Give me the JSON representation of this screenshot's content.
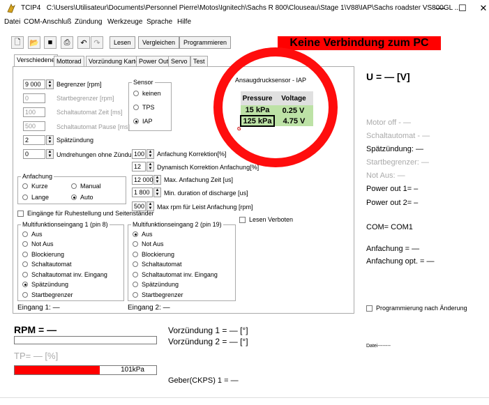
{
  "window": {
    "app_name": "TCIP4",
    "path": "C:\\Users\\Utilisateur\\Documents\\Personnel Pierre\\Motos\\Ignitech\\Sachs R 800\\Clouseau\\Stage 1\\V88\\IAP\\Sachs roadster VS800GL ...",
    "minimize": "—",
    "maximize": "☐",
    "close": "✕"
  },
  "menu": [
    "Datei",
    "COM-Anschluß",
    "Zündung",
    "Werkzeuge",
    "Sprache",
    "Hilfe"
  ],
  "toolbar": {
    "icons": [
      "new-file-icon",
      "open-folder-icon",
      "save-icon",
      "print-icon",
      "undo-icon",
      "redo-icon"
    ],
    "lesen": "Lesen",
    "vergleichen": "Vergleichen",
    "programmieren": "Programmieren",
    "status_banner": "Keine Verbindung zum PC",
    "status_color": "#ff0000"
  },
  "tabs": [
    "Verschiedene",
    "Mottorad",
    "Vorzündung Karte",
    "Power Out",
    "Servo",
    "Test"
  ],
  "left": {
    "begrenzer_val": "9 000",
    "begrenzer_lbl": "Begrenzer [rpm]",
    "startbegrenzer_val": "0",
    "startbegrenzer_lbl": "Startbegrenzer [rpm]",
    "schaltautomat_zeit_val": "100",
    "schaltautomat_zeit_lbl": "Schaltautomat Zeit [ms]",
    "schaltautomat_pause_val": "500",
    "schaltautomat_pause_lbl": "Schaltautomat Pause [ms]",
    "spaetzuendung_val": "2",
    "spaetzuendung_lbl": "Spätzündung",
    "umdrehungen_val": "0",
    "umdrehungen_lbl": "Umdrehungen ohne Zündung"
  },
  "sensor": {
    "title": "Sensor",
    "options": [
      "keinen",
      "TPS",
      "IAP"
    ],
    "selected": 2
  },
  "anfachung": {
    "title": "Anfachung",
    "options": [
      "Kurze",
      "Manual",
      "Lange",
      "Auto"
    ],
    "selected": 3
  },
  "mid": {
    "max_anfachung_korr_val": "100",
    "max_anfachung_korr_lbl": "Anfachung Korrektion[%]",
    "dyn_korr_val": "12",
    "dyn_korr_lbl": "Dynamisch Korrektion Anfachung[%]",
    "max_anf_zeit_val": "12 000",
    "max_anf_zeit_lbl": "Max. Anfachung Zeit  [us]",
    "min_duration_val": "1 800",
    "min_duration_lbl": "Min. duration of discharge [us]",
    "max_rpm_val": "500",
    "max_rpm_lbl": "Max rpm für Leist Anfachung [rpm]"
  },
  "eingaenge_label": "Eingänge für Ruhestellung und Seitenständer",
  "lesen_verboten": "Lesen Verboten",
  "mf1": {
    "title": "Multifunktionseingang 1 (pin 8)",
    "options": [
      "Aus",
      "Not Aus",
      "Blockierung",
      "Schaltautomat",
      "Schaltautomat inv. Eingang",
      "Spätzündung",
      "Startbegrenzer"
    ],
    "selected": 5,
    "status": "Eingang 1: —"
  },
  "mf2": {
    "title": "Multifunktionseingang 2 (pin 19)",
    "options": [
      "Aus",
      "Not Aus",
      "Blockierung",
      "Schaltautomat",
      "Schaltautomat inv. Eingang",
      "Spätzündung",
      "Startbegrenzer"
    ],
    "selected": 0,
    "status": "Eingang 2: —"
  },
  "iap": {
    "title": "Ansaugdrucksensor - IAP",
    "headers": [
      "Pressure",
      "Voltage"
    ],
    "rows": [
      [
        "15 kPa",
        "0.25 V"
      ],
      [
        "125 kPa",
        "4.75 V"
      ]
    ],
    "marker": "G"
  },
  "right": {
    "voltage": "U = — [V]",
    "motor_off": "Motor off - —",
    "schaltautomat": "Schaltautomat - —",
    "spaetzuendung": "Spätzündung: —",
    "startbegrenzer": "Startbegrenzer: —",
    "not_aus": "Not Aus: —",
    "power_out1": "Power out 1= –",
    "power_out2": "Power out 2= –",
    "com": "COM= COM1",
    "anfachung": "Anfachung = —",
    "anfachung_opt": "Anfachung opt. = —",
    "programmierung": "Programmierung nach Änderung",
    "datei": "Datei--------"
  },
  "bottom": {
    "rpm": "RPM = —",
    "tp": "TP= — [%]",
    "pressure_val": "101kPa",
    "pressure_fill": 0.6,
    "bar_color": "#ff0000",
    "vorzuendung1": "Vorzündung 1 = — [°]",
    "vorzuendung2": "Vorzündung 2 = — [°]",
    "geber": "Geber(CKPS) 1 = —"
  }
}
